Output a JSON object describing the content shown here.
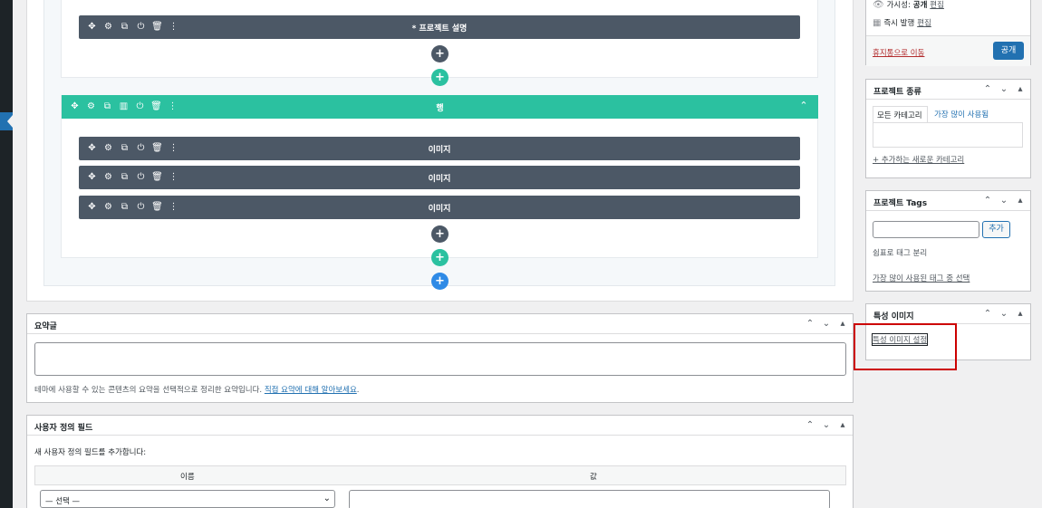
{
  "builder": {
    "module_top_title": "* 프로젝트 설명",
    "row_title": "행",
    "modules": [
      "이미지",
      "이미지",
      "이미지"
    ],
    "add_symbol": "+",
    "collapse_symbol": "^"
  },
  "publish": {
    "visibility_label": "가시성:",
    "visibility_value": "공개",
    "visibility_edit": "편집",
    "schedule_label": "즉시 발행",
    "schedule_edit": "편집",
    "trash_link": "휴지통으로 이동",
    "publish_button": "공개"
  },
  "categories_box": {
    "title": "프로젝트 종류",
    "tab_all": "모든 카테고리",
    "tab_popular": "가장 많이 사용됨",
    "add_new_link": "+ 추가하는 새로운 카테고리"
  },
  "tags_box": {
    "title": "프로젝트 Tags",
    "add_button": "추가",
    "hint": "쉼표로 태그 분리",
    "popular_link": "가장 많이 사용된 태그 중 선택"
  },
  "featured_box": {
    "title": "특성 이미지",
    "set_link": "특성 이미지 설정"
  },
  "excerpt_box": {
    "title": "요약글",
    "help_text": "테마에 사용할 수 있는 콘텐츠의 요약을 선택적으로 정리한 요약입니다.",
    "help_link": "직접 요약에 대해 알아보세요",
    "help_suffix": "."
  },
  "custom_fields_box": {
    "title": "사용자 정의 필드",
    "intro": "새 사용자 정의 필드를 추가합니다:",
    "col_name": "이름",
    "col_value": "값",
    "select_value": "— 선택 —"
  },
  "colors": {
    "module_bg": "#4c5866",
    "row_bg": "#2bc1a0",
    "add_blue": "#2e8ae6",
    "link": "#2271b1",
    "danger": "#b32d2e",
    "highlight": "#cc0000"
  }
}
